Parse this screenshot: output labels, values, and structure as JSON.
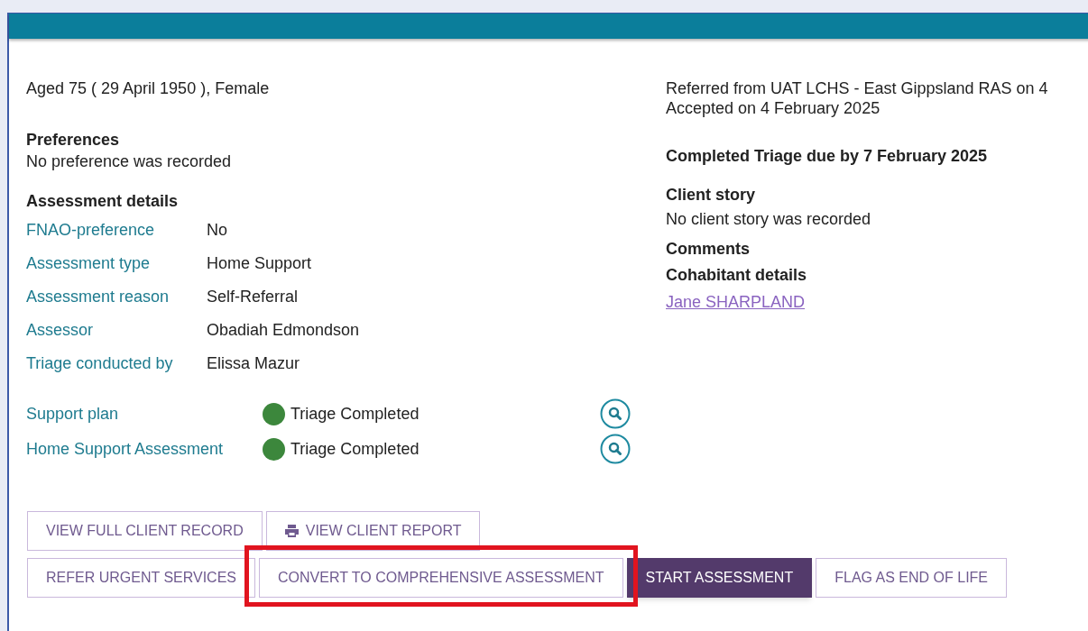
{
  "client": {
    "summary": "Aged 75 ( 29 April 1950 ), Female"
  },
  "referral": {
    "referred": "Referred from UAT LCHS - East Gippsland RAS on 4",
    "accepted": "Accepted on 4 February 2025"
  },
  "preferences": {
    "heading": "Preferences",
    "text": "No preference was recorded"
  },
  "triage_due": "Completed Triage due by 7 February 2025",
  "client_story": {
    "heading": "Client story",
    "text": "No client story was recorded"
  },
  "comments": {
    "heading": "Comments"
  },
  "cohabitant": {
    "heading": "Cohabitant details",
    "link": "Jane SHARPLAND"
  },
  "assessment_details": {
    "heading": "Assessment details",
    "rows": [
      {
        "label": "FNAO-preference",
        "value": "No"
      },
      {
        "label": "Assessment type",
        "value": "Home Support"
      },
      {
        "label": "Assessment reason",
        "value": "Self-Referral"
      },
      {
        "label": "Assessor",
        "value": "Obadiah Edmondson"
      },
      {
        "label": "Triage conducted by",
        "value": "Elissa Mazur"
      }
    ]
  },
  "plans": [
    {
      "label": "Support plan",
      "status": "Triage Completed",
      "color": "#3c873c"
    },
    {
      "label": "Home Support Assessment",
      "status": "Triage Completed",
      "color": "#3c873c"
    }
  ],
  "button_rows": [
    [
      {
        "label": "VIEW FULL CLIENT RECORD",
        "kind": "outline",
        "highlighted": false
      },
      {
        "label": "VIEW CLIENT REPORT",
        "kind": "print",
        "highlighted": false
      }
    ],
    [
      {
        "label": "REFER URGENT SERVICES",
        "kind": "outline",
        "highlighted": false
      },
      {
        "label": "CONVERT TO COMPREHENSIVE ASSESSMENT",
        "kind": "outline",
        "highlighted": true
      },
      {
        "label": "START ASSESSMENT",
        "kind": "primary",
        "highlighted": false
      },
      {
        "label": "FLAG AS END OF LIFE",
        "kind": "outline",
        "highlighted": false
      }
    ]
  ]
}
